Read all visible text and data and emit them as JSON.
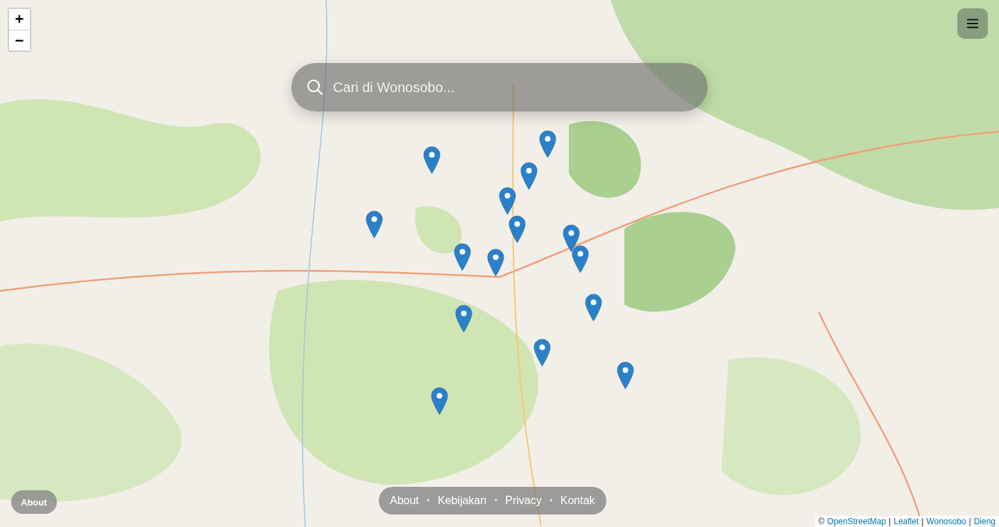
{
  "zoom": {
    "in": "+",
    "out": "−"
  },
  "search": {
    "placeholder": "Cari di Wonosobo..."
  },
  "about_button": "About",
  "footer": {
    "separator": "•",
    "links": [
      "About",
      "Kebijakan",
      "Privacy",
      "Kontak"
    ]
  },
  "attribution": {
    "prefix": "©",
    "links": [
      "OpenStreetMap",
      "Leaflet",
      "Wonosobo",
      "Dieng"
    ],
    "separator": "|"
  }
}
